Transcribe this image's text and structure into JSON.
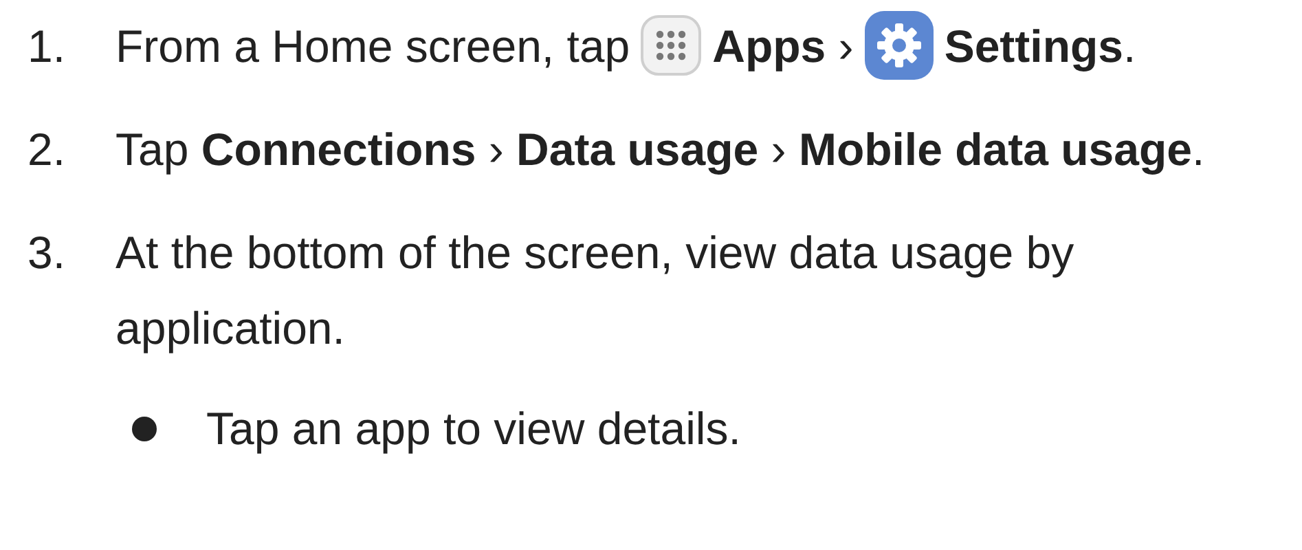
{
  "steps": [
    {
      "number": "1.",
      "parts": [
        {
          "kind": "text",
          "text": "From a Home screen, tap"
        },
        {
          "kind": "apps"
        },
        {
          "kind": "text",
          "text": "**Apps** ›"
        },
        {
          "kind": "settings"
        },
        {
          "kind": "text",
          "text": "**Settings**."
        }
      ]
    },
    {
      "number": "2.",
      "parts": [
        {
          "kind": "text",
          "text": "Tap **Connections** › **Data usage** › **Mobile data usage**."
        }
      ]
    },
    {
      "number": "3.",
      "parts": [
        {
          "kind": "text",
          "text": "At the bottom of the screen, view data usage by application."
        }
      ],
      "bullets": [
        "Tap an app to view details."
      ]
    }
  ]
}
